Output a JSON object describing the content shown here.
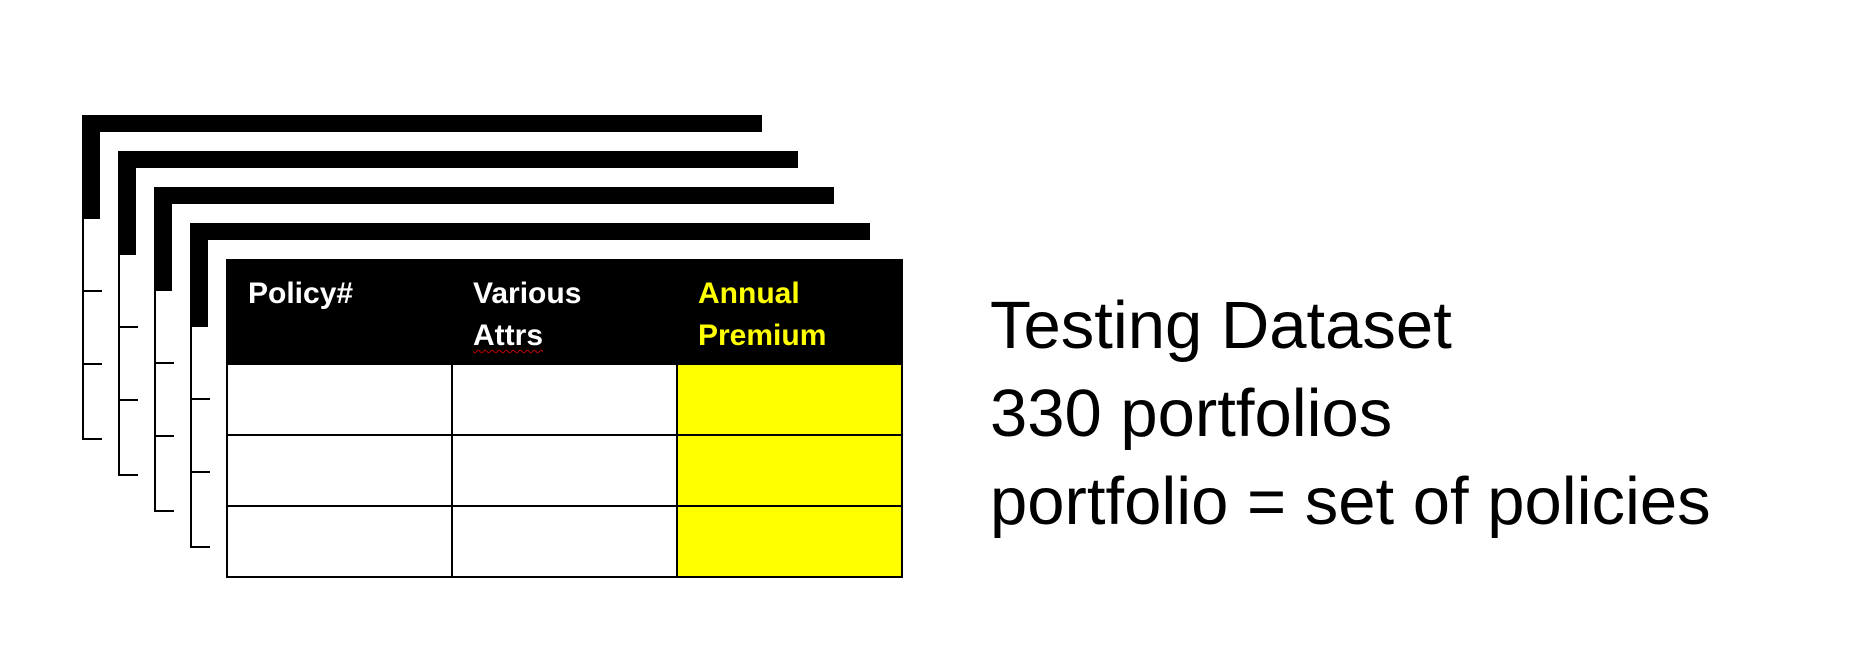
{
  "diagram": {
    "stacked_sheet_count": 4,
    "table": {
      "columns": [
        {
          "label_line1": "Policy#",
          "label_line2": "",
          "highlight": false
        },
        {
          "label_line1": "Various",
          "label_line2": "Attrs",
          "highlight": false
        },
        {
          "label_line1": "Annual",
          "label_line2": "Premium",
          "highlight": true
        }
      ],
      "empty_row_count": 3,
      "colors": {
        "header_background": "#000000",
        "header_text": "#ffffff",
        "highlight": "#ffff00",
        "grid": "#000000"
      }
    }
  },
  "caption": {
    "line1": "Testing Dataset",
    "line2": "330 portfolios",
    "line3": "portfolio = set of policies"
  }
}
